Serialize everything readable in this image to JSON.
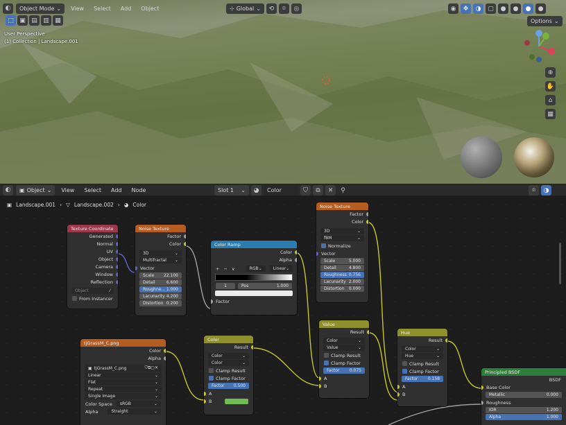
{
  "top_header": {
    "mode": "Object Mode",
    "menus": [
      "View",
      "Select",
      "Add",
      "Object"
    ],
    "transform": "Global",
    "options": "Options"
  },
  "viewport": {
    "line1": "User Perspective",
    "line2": "(1) Collection | Landscape.001"
  },
  "node_header": {
    "editor_type": "Object",
    "menus": [
      "View",
      "Select",
      "Add",
      "Node"
    ],
    "slot": "Slot 1",
    "material": "Color"
  },
  "breadcrumb": [
    "Landscape.001",
    "Landscape.002",
    "Color"
  ],
  "nodes": {
    "tex_coord": {
      "title": "Texture Coordinate",
      "outputs": [
        "Generated",
        "Normal",
        "UV",
        "Object",
        "Camera",
        "Window",
        "Reflection"
      ],
      "object_placeholder": "Object",
      "from_instancer": "From Instancer"
    },
    "noise1": {
      "title": "Noise Texture",
      "outputs": [
        "Factor",
        "Color"
      ],
      "dim": "3D",
      "type": "Multifractal",
      "vector": "Vector",
      "fields": [
        {
          "l": "Scale",
          "v": "22.100"
        },
        {
          "l": "Detail",
          "v": "6.600"
        },
        {
          "l": "Roughne...",
          "v": "1.000"
        },
        {
          "l": "Lacunarity",
          "v": "4.200"
        },
        {
          "l": "Distortion",
          "v": "0.200"
        }
      ]
    },
    "colorramp": {
      "title": "Color Ramp",
      "outputs": [
        "Color",
        "Alpha"
      ],
      "mode": "RGB",
      "interp": "Linear",
      "stop": "1",
      "pos_label": "Pos",
      "pos": "1.000",
      "factor": "Factor",
      "buttons": [
        "+",
        "−",
        "∨"
      ]
    },
    "noise2": {
      "title": "Noise Texture",
      "outputs": [
        "Factor",
        "Color"
      ],
      "dim": "3D",
      "type": "fBM",
      "normalize": "Normalize",
      "vector": "Vector",
      "fields": [
        {
          "l": "Scale",
          "v": "5.000"
        },
        {
          "l": "Detail",
          "v": "4.800"
        },
        {
          "l": "Roughness",
          "v": "0.756"
        },
        {
          "l": "Lacunarity",
          "v": "2.000"
        },
        {
          "l": "Distortion",
          "v": "0.000"
        }
      ]
    },
    "image": {
      "title": "tjGrassM_C.png",
      "outputs": [
        "Color",
        "Alpha"
      ],
      "file": "tjGrassM_C.png",
      "opts": [
        "Linear",
        "Flat",
        "Repeat",
        "Single Image"
      ],
      "cs_label": "Color Space",
      "cs": "sRGB",
      "alpha_label": "Alpha",
      "alpha": "Straight"
    },
    "mix1": {
      "title": "Color",
      "output": "Result",
      "d1": "Color",
      "d2": "Color",
      "clamp_result": "Clamp Result",
      "clamp_factor": "Clamp Factor",
      "factor_label": "Factor",
      "factor": "0.500",
      "a": "A",
      "b": "B",
      "swatch": "#6fbd51"
    },
    "mix2": {
      "title": "Value",
      "output": "Result",
      "d1": "Color",
      "d2": "Value",
      "clamp_result": "Clamp Result",
      "clamp_factor": "Clamp Factor",
      "factor_label": "Factor",
      "factor": "0.075",
      "a": "A",
      "b": "B"
    },
    "mix3": {
      "title": "Hue",
      "output": "Result",
      "d1": "Color",
      "d2": "Hue",
      "clamp_result": "Clamp Result",
      "clamp_factor": "Clamp Factor",
      "factor_label": "Factor",
      "factor": "0.158",
      "a": "A",
      "b": "B"
    },
    "bsdf": {
      "title": "Principled BSDF",
      "output": "BSDF",
      "base": "Base Color",
      "metallic": "Metallic",
      "metallic_v": "0.000",
      "roughness": "Roughness",
      "ior": "IOR",
      "ior_v": "1.200",
      "alpha": "Alpha",
      "alpha_v": "1.000"
    }
  },
  "colors": {
    "input_header": "#9c3849",
    "texture_header": "#b55c21",
    "converter_header": "#2b7db0",
    "color_header": "#8f8f2d",
    "shader_header": "#2e7f3b",
    "yellow_socket": "#c7c729",
    "purple_socket": "#6363c7",
    "gray_socket": "#a1a1a1"
  }
}
